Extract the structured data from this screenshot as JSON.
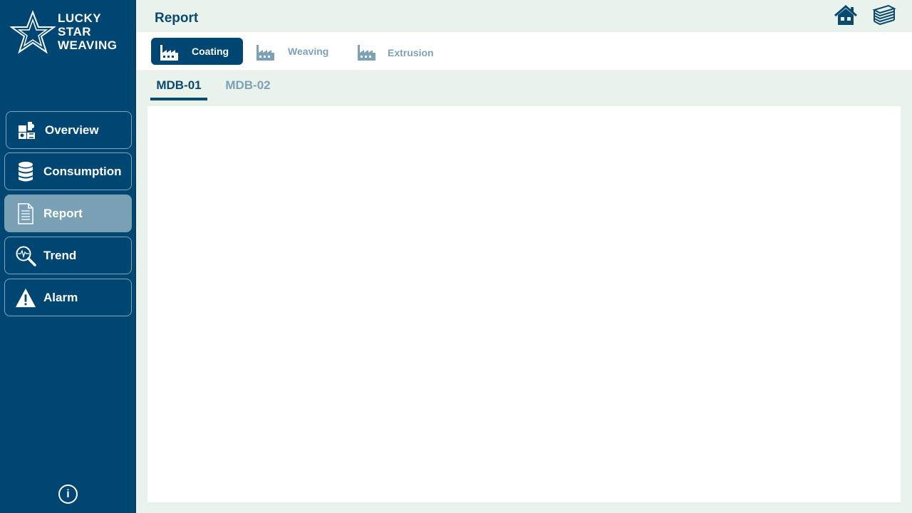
{
  "brand": {
    "line1": "LUCKY",
    "line2": "STAR",
    "line3": "WEAVING"
  },
  "sidebar": {
    "items": [
      {
        "label": "Overview",
        "icon": "puzzle-icon",
        "active": false
      },
      {
        "label": "Consumption",
        "icon": "database-icon",
        "active": false
      },
      {
        "label": "Report",
        "icon": "document-icon",
        "active": true
      },
      {
        "label": "Trend",
        "icon": "magnifier-pulse-icon",
        "active": false
      },
      {
        "label": "Alarm",
        "icon": "warning-icon",
        "active": false
      }
    ],
    "info_label": "i"
  },
  "header": {
    "title": "Report",
    "icons": [
      "home-icon",
      "layers-icon"
    ]
  },
  "plant_tabs": [
    {
      "label": "Coating",
      "icon": "factory-icon",
      "active": true
    },
    {
      "label": "Weaving",
      "icon": "factory-icon",
      "active": false
    },
    {
      "label": "Extrusion",
      "icon": "factory-icon",
      "active": false
    }
  ],
  "sub_tabs": [
    {
      "label": "MDB-01",
      "active": true
    },
    {
      "label": "MDB-02",
      "active": false
    }
  ],
  "colors": {
    "sidebar_bg": "#004672",
    "active_nav": "#79a0b5",
    "page_bg": "#eaf2ec",
    "accent": "#0a4a70",
    "inactive_text": "#7da2b7"
  }
}
